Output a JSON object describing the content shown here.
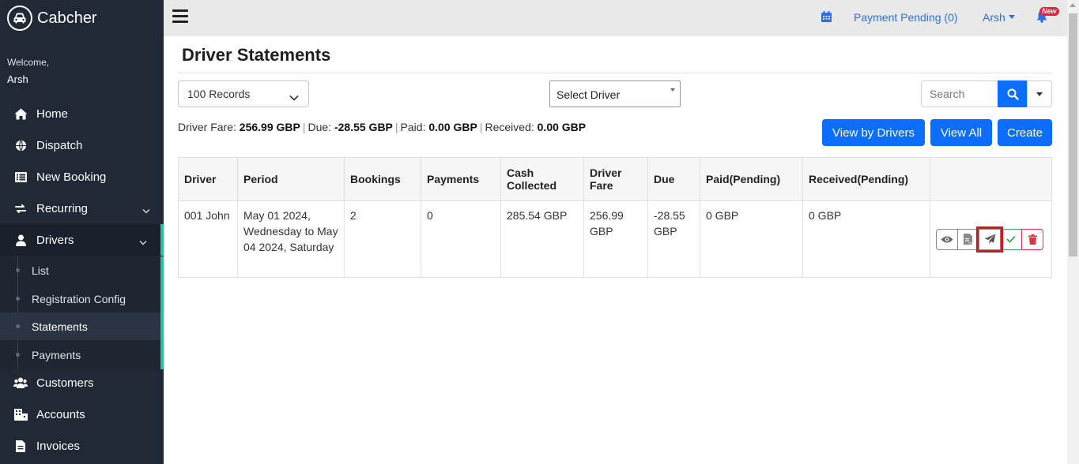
{
  "app": {
    "name": "Cabcher"
  },
  "sidebar": {
    "welcome": "Welcome,",
    "user": "Arsh",
    "items": [
      {
        "label": "Home",
        "icon": "home-icon"
      },
      {
        "label": "Dispatch",
        "icon": "globe-icon"
      },
      {
        "label": "New Booking",
        "icon": "list-icon"
      },
      {
        "label": "Recurring",
        "icon": "repeat-icon"
      },
      {
        "label": "Drivers",
        "icon": "user-icon"
      },
      {
        "label": "Customers",
        "icon": "users-icon"
      },
      {
        "label": "Accounts",
        "icon": "building-icon"
      },
      {
        "label": "Invoices",
        "icon": "file-icon"
      }
    ],
    "drivers_sub": [
      "List",
      "Registration Config",
      "Statements",
      "Payments"
    ]
  },
  "topbar": {
    "payment_pending": "Payment Pending (0)",
    "user_menu": "Arsh",
    "new_badge": "New"
  },
  "page": {
    "title": "Driver Statements",
    "records_select": "100 Records",
    "driver_select": "Select Driver",
    "search_placeholder": "Search",
    "summary": {
      "driver_fare_label": "Driver Fare:",
      "driver_fare": "256.99 GBP",
      "due_label": "Due:",
      "due": "-28.55 GBP",
      "paid_label": "Paid:",
      "paid": "0.00 GBP",
      "received_label": "Received:",
      "received": "0.00 GBP"
    },
    "buttons": {
      "view_by_drivers": "View by Drivers",
      "view_all": "View All",
      "create": "Create"
    }
  },
  "table": {
    "headers": [
      "Driver",
      "Period",
      "Bookings",
      "Payments",
      "Cash Collected",
      "Driver Fare",
      "Due",
      "Paid(Pending)",
      "Received(Pending)",
      ""
    ],
    "rows": [
      {
        "driver": "001 John",
        "period": "May 01 2024, Wednesday to May 04 2024, Saturday",
        "bookings": "2",
        "payments": "0",
        "cash_collected": "285.54 GBP",
        "driver_fare": "256.99 GBP",
        "due": "-28.55 GBP",
        "paid_pending": "0 GBP",
        "received_pending": "0 GBP"
      }
    ]
  },
  "colors": {
    "primary": "#0d6efd",
    "sidebar": "#212936",
    "accent": "#2fbfa0",
    "danger": "#dc3545",
    "success": "#3aa65b"
  }
}
